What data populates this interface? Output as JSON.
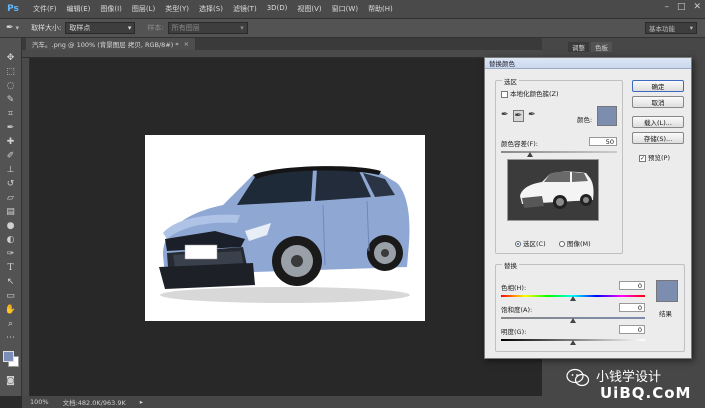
{
  "app": {
    "logo_text": "Ps"
  },
  "menubar": {
    "items": [
      "文件(F)",
      "编辑(E)",
      "图像(I)",
      "图层(L)",
      "类型(Y)",
      "选择(S)",
      "滤镜(T)",
      "3D(D)",
      "视图(V)",
      "窗口(W)",
      "帮助(H)"
    ]
  },
  "optionsbar": {
    "sample_size_label": "取样大小:",
    "sample_size_value": "取样点",
    "sample_label": "样本:",
    "sample_value": "所有图层",
    "workspace": "基本功能"
  },
  "document_tab": {
    "title": "汽车。.png @ 100% (背景图层 拷贝, RGB/8#) *"
  },
  "statusbar": {
    "zoom": "100%",
    "doc_info": "文档:482.0K/963.9K"
  },
  "panels": {
    "tabs": [
      "调整",
      "色板"
    ]
  },
  "dialog": {
    "title": "替换颜色",
    "selection": {
      "group_label": "选区",
      "localized_checkbox": "本地化颜色簇(Z)",
      "localized_checked": false,
      "color_label": "颜色:",
      "color_swatch": "#7d8db0",
      "fuzziness_label": "颜色容差(F):",
      "fuzziness_value": "50",
      "fuzziness_level": 0.25,
      "radio_selection": "选区(C)",
      "radio_image": "图像(M)",
      "radio_selected": "选区(C)"
    },
    "replacement": {
      "group_label": "替换",
      "hue_label": "色相(H):",
      "hue_value": "0",
      "saturation_label": "饱和度(A):",
      "saturation_value": "0",
      "lightness_label": "明度(G):",
      "lightness_value": "0",
      "result_label": "结果",
      "result_swatch": "#7d8db0"
    },
    "buttons": {
      "ok": "确定",
      "cancel": "取消",
      "load": "载入(L)...",
      "save": "存储(S)...",
      "preview": "预览(P)",
      "preview_checked": true
    }
  },
  "watermark": {
    "line1": "小钱学设计",
    "line2": "UiBQ.CoM"
  }
}
